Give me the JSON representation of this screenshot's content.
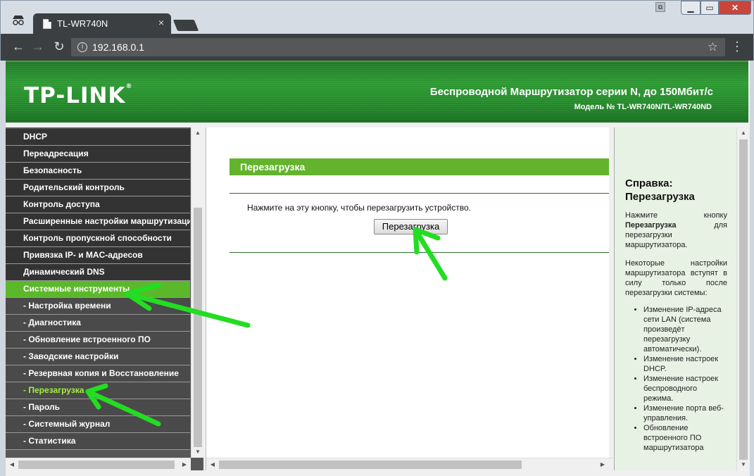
{
  "browser": {
    "tab_title": "TL-WR740N",
    "tab_close": "×",
    "url": "192.168.0.1",
    "icons": [
      "incognito-icon",
      "back-icon",
      "forward-icon",
      "reload-icon",
      "info-icon",
      "star-icon",
      "menu-icon"
    ]
  },
  "banner": {
    "logo": "TP-LINK",
    "logo_mark": "®",
    "title": "Беспроводной Маршрутизатор серии N, до 150Мбит/с",
    "model": "Модель № TL-WR740N/TL-WR740ND"
  },
  "menu": {
    "items": [
      {
        "label": "DHCP",
        "type": "main"
      },
      {
        "label": "Переадресация",
        "type": "main"
      },
      {
        "label": "Безопасность",
        "type": "main"
      },
      {
        "label": "Родительский контроль",
        "type": "main"
      },
      {
        "label": "Контроль доступа",
        "type": "main"
      },
      {
        "label": "Расширенные настройки маршрутизации",
        "type": "main"
      },
      {
        "label": "Контроль пропускной способности",
        "type": "main"
      },
      {
        "label": "Привязка IP- и MAC-адресов",
        "type": "main"
      },
      {
        "label": "Динамический DNS",
        "type": "main"
      },
      {
        "label": "Системные инструменты",
        "type": "active"
      },
      {
        "label": "- Настройка времени",
        "type": "sub"
      },
      {
        "label": "- Диагностика",
        "type": "sub"
      },
      {
        "label": "- Обновление встроенного ПО",
        "type": "sub"
      },
      {
        "label": "- Заводские настройки",
        "type": "sub"
      },
      {
        "label": "- Резервная копия и Восстановление",
        "type": "sub"
      },
      {
        "label": "- Перезагрузка",
        "type": "current"
      },
      {
        "label": "- Пароль",
        "type": "sub"
      },
      {
        "label": "- Системный журнал",
        "type": "sub"
      },
      {
        "label": "- Статистика",
        "type": "sub"
      }
    ]
  },
  "main": {
    "heading": "Перезагрузка",
    "instruction": "Нажмите на эту кнопку, чтобы перезагрузить устройство.",
    "reboot_button": "Перезагрузка"
  },
  "help": {
    "title_line1": "Справка:",
    "title_line2": "Перезагрузка",
    "p1_before": "Нажмите кнопку ",
    "p1_bold": "Перезагрузка",
    "p1_after": " для перезагрузки маршрутизатора.",
    "p2": "Некоторые настройки маршрутизатора вступят в силу только после перезагрузки системы:",
    "list": [
      "Изменение IP-адреса сети LAN (система произведёт перезагрузку автоматически).",
      "Изменение настроек DHCP.",
      "Изменение настроек беспроводного режима.",
      "Изменение порта веб-управления.",
      "Обновление встроенного ПО маршрутизатора"
    ]
  },
  "colors": {
    "banner_green": "#2f9a34",
    "menu_active": "#5cb82b",
    "menu_current_text": "#a5ee40",
    "annotation_arrow": "#22dd22"
  }
}
